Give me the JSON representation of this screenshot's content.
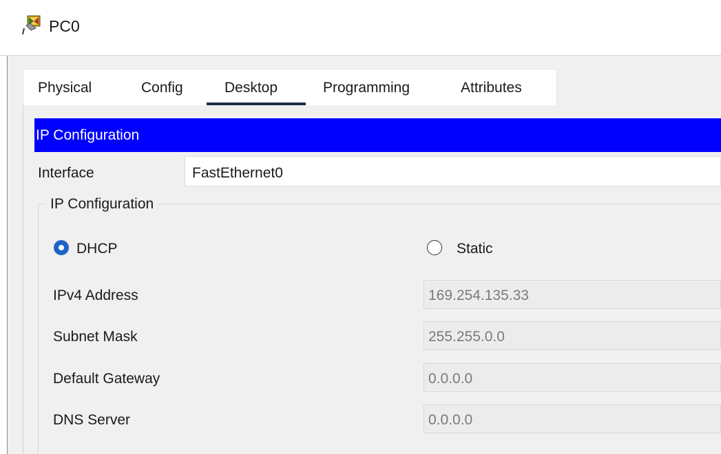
{
  "window": {
    "title": "PC0",
    "icon": "pc-icon"
  },
  "tabs": [
    {
      "label": "Physical"
    },
    {
      "label": "Config"
    },
    {
      "label": "Desktop",
      "active": true
    },
    {
      "label": "Programming"
    },
    {
      "label": "Attributes"
    }
  ],
  "panel": {
    "header": "IP Configuration",
    "interface_label": "Interface",
    "interface_value": "FastEthernet0",
    "group_label": "IP Configuration",
    "mode": {
      "dhcp_label": "DHCP",
      "static_label": "Static",
      "selected": "DHCP"
    },
    "fields": [
      {
        "label": "IPv4 Address",
        "value": "169.254.135.33"
      },
      {
        "label": "Subnet Mask",
        "value": "255.255.0.0"
      },
      {
        "label": "Default Gateway",
        "value": "0.0.0.0"
      },
      {
        "label": "DNS Server",
        "value": "0.0.0.0"
      }
    ]
  },
  "colors": {
    "header_bg": "#0000ff",
    "radio_accent": "#1e63c8",
    "active_tab_underline": "#1f2e4a"
  }
}
